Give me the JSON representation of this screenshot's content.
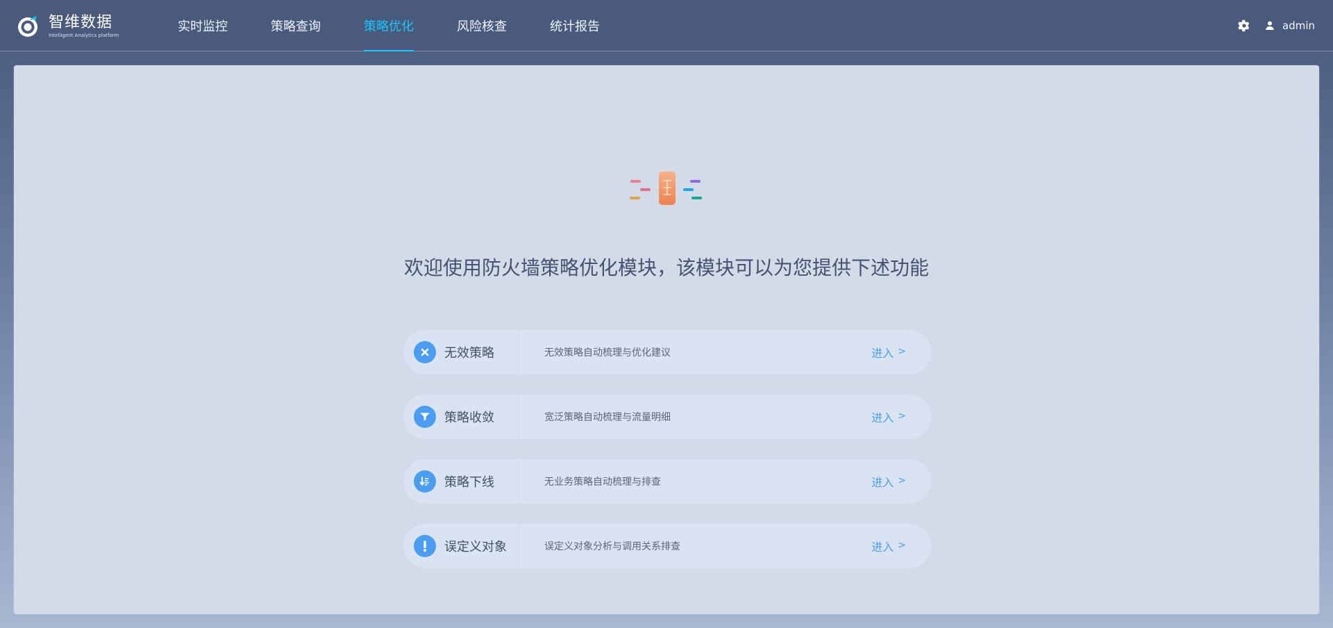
{
  "brand": {
    "title": "智维数据",
    "subtitle": "Intelligent Analytics platform",
    "logo_icon": "target-logo-icon"
  },
  "nav": {
    "items": [
      {
        "label": "实时监控",
        "active": false
      },
      {
        "label": "策略查询",
        "active": false
      },
      {
        "label": "策略优化",
        "active": true
      },
      {
        "label": "风险核查",
        "active": false
      },
      {
        "label": "统计报告",
        "active": false
      }
    ]
  },
  "header": {
    "settings_icon": "gear-icon",
    "user_icon": "user-icon",
    "username": "admin"
  },
  "hero": {
    "title": "欢迎使用防火墙策略优化模块，该模块可以为您提供下述功能",
    "icon": "policy-optimization-hero-icon"
  },
  "features": [
    {
      "icon": "close-icon",
      "name": "无效策略",
      "description": "无效策略自动梳理与优化建议",
      "action": "进入",
      "action_arrow": ">"
    },
    {
      "icon": "filter-icon",
      "name": "策略收敛",
      "description": "宽泛策略自动梳理与流量明细",
      "action": "进入",
      "action_arrow": ">"
    },
    {
      "icon": "sort-down-icon",
      "name": "策略下线",
      "description": "无业务策略自动梳理与排查",
      "action": "进入",
      "action_arrow": ">"
    },
    {
      "icon": "exclamation-icon",
      "name": "误定义对象",
      "description": "误定义对象分析与调用关系排查",
      "action": "进入",
      "action_arrow": ">"
    }
  ],
  "colors": {
    "header_bg": "#4a5a7c",
    "active_nav": "#19c6ff",
    "panel_bg": "#d3dbe8",
    "feature_bg": "#d9e3f2",
    "accent": "#4a9df0",
    "hero_text": "#44536f"
  }
}
